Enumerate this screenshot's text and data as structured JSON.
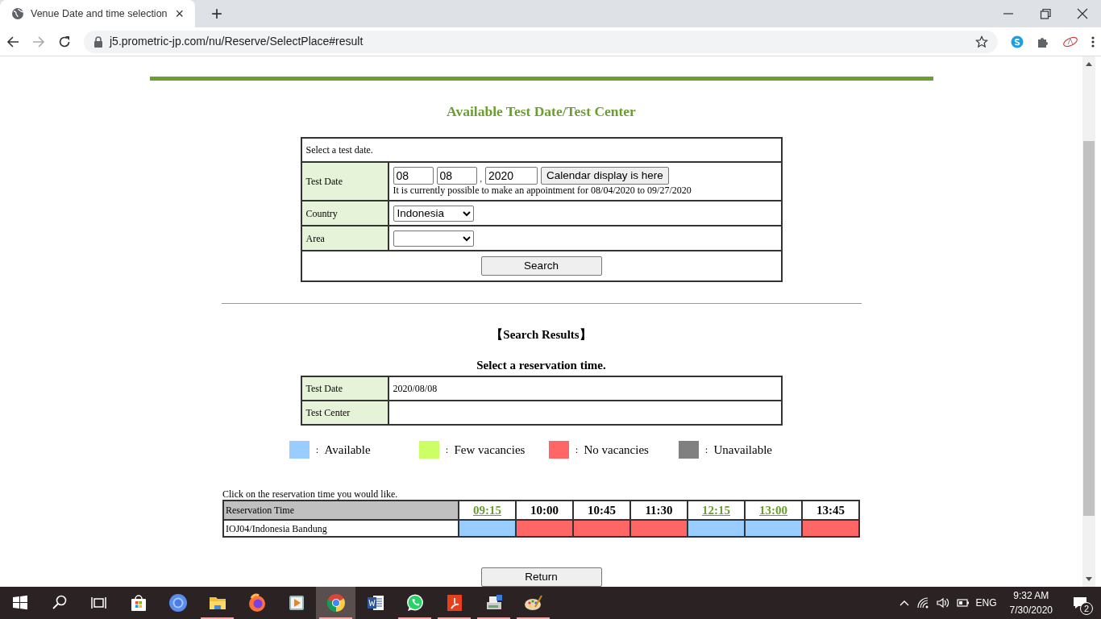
{
  "browser": {
    "tab": {
      "title": "Venue Date and time selection",
      "close": "×"
    },
    "new_tab": "+",
    "address": "j5.prometric-jp.com/nu/Reserve/SelectPlace#result"
  },
  "page": {
    "title": "Available Test Date/Test Center",
    "form": {
      "instruction": "Select a test date.",
      "date_label": "Test Date",
      "month": "08",
      "day": "08",
      "separator": ",",
      "year": "2020",
      "calendar_button": "Calendar display is here",
      "note": "It is currently possible to make an appointment for 08/04/2020 to 09/27/2020",
      "country_label": "Country",
      "country": "Indonesia",
      "area_label": "Area",
      "search_button": "Search"
    },
    "results_heading": "【Search Results】",
    "results_subheading": "Select a reservation time.",
    "summary": [
      {
        "label": "Test Date",
        "value": "2020/08/08"
      },
      {
        "label": "Test Center"
      }
    ],
    "legend": [
      {
        "kind": "available",
        "color": "#99ccff",
        "mark": "：",
        "label": "Available"
      },
      {
        "kind": "few",
        "color": "#ccff66",
        "mark": "：",
        "label": "Few vacancies"
      },
      {
        "kind": "none",
        "color": "#ff6666",
        "mark": "：",
        "label": "No vacancies"
      },
      {
        "kind": "unavailable",
        "color": "#808080",
        "mark": "：",
        "label": "Unavailable"
      }
    ],
    "reservation": {
      "prompt": "Click on the reservation time you would like.",
      "header": "Reservation Time",
      "slots": [
        {
          "time": "09:15",
          "kind": "available"
        },
        {
          "time": "10:00",
          "kind": "none"
        },
        {
          "time": "10:45",
          "kind": "none"
        },
        {
          "time": "11:30",
          "kind": "none"
        },
        {
          "time": "12:15",
          "kind": "available"
        },
        {
          "time": "13:00",
          "kind": "available"
        },
        {
          "time": "13:45",
          "kind": "none"
        }
      ],
      "rows": [
        {
          "center": "IOJ04/Indonesia Bandung"
        }
      ]
    },
    "return_button": "Return"
  },
  "taskbar": {
    "apps": [
      {
        "kind": "store",
        "running": false,
        "selected": false
      },
      {
        "kind": "chromium",
        "running": false,
        "selected": false
      },
      {
        "kind": "folder",
        "running": true,
        "selected": false
      },
      {
        "kind": "firefox",
        "running": false,
        "selected": false
      },
      {
        "kind": "player",
        "running": false,
        "selected": false
      },
      {
        "kind": "chrome",
        "running": true,
        "selected": true
      },
      {
        "kind": "word",
        "running": false,
        "selected": false
      },
      {
        "kind": "whatsapp",
        "running": true,
        "selected": false
      },
      {
        "kind": "acrobat",
        "running": true,
        "selected": false
      },
      {
        "kind": "printer",
        "running": true,
        "selected": false
      },
      {
        "kind": "paint",
        "running": true,
        "selected": false
      }
    ],
    "tray": {
      "language": "ENG",
      "time": "9:32 AM",
      "date": "7/30/2020",
      "notifications": "2"
    }
  }
}
